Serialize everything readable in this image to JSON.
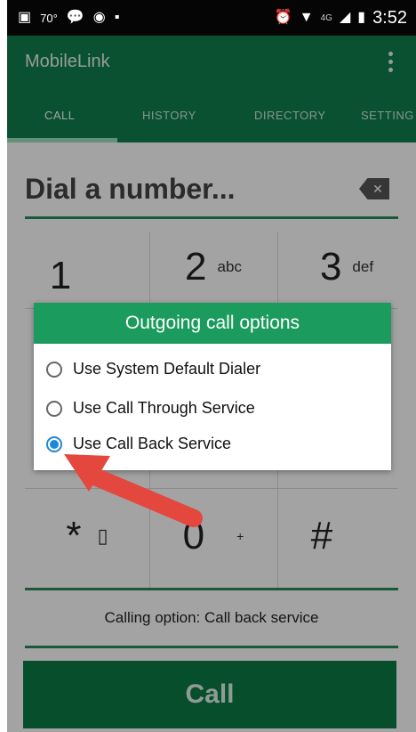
{
  "status_bar": {
    "temperature": "70°",
    "network": "4G",
    "time": "3:52"
  },
  "app_bar": {
    "title": "MobileLink"
  },
  "tabs": [
    {
      "label": "CALL",
      "selected": true
    },
    {
      "label": "HISTORY",
      "selected": false
    },
    {
      "label": "DIRECTORY",
      "selected": false
    },
    {
      "label": "SETTING",
      "selected": false
    }
  ],
  "dial": {
    "placeholder": "Dial a number..."
  },
  "keypad": {
    "keys": [
      {
        "digit": "1",
        "letters": ""
      },
      {
        "digit": "2",
        "letters": "abc"
      },
      {
        "digit": "3",
        "letters": "def"
      },
      {
        "digit": "*",
        "letters": ""
      },
      {
        "digit": "0",
        "letters": "+"
      },
      {
        "digit": "#",
        "letters": ""
      }
    ]
  },
  "calling_option": "Calling option: Call back service",
  "call_button": "Call",
  "dialog": {
    "title": "Outgoing call options",
    "options": [
      {
        "label": "Use System Default Dialer",
        "selected": false
      },
      {
        "label": "Use Call Through Service",
        "selected": false
      },
      {
        "label": "Use Call Back Service",
        "selected": true
      }
    ]
  },
  "colors": {
    "primary": "#0f7f4d",
    "dialog_header": "#1b9b5e",
    "radio_selected": "#1e88d8",
    "annotation_arrow": "#e4473d"
  }
}
